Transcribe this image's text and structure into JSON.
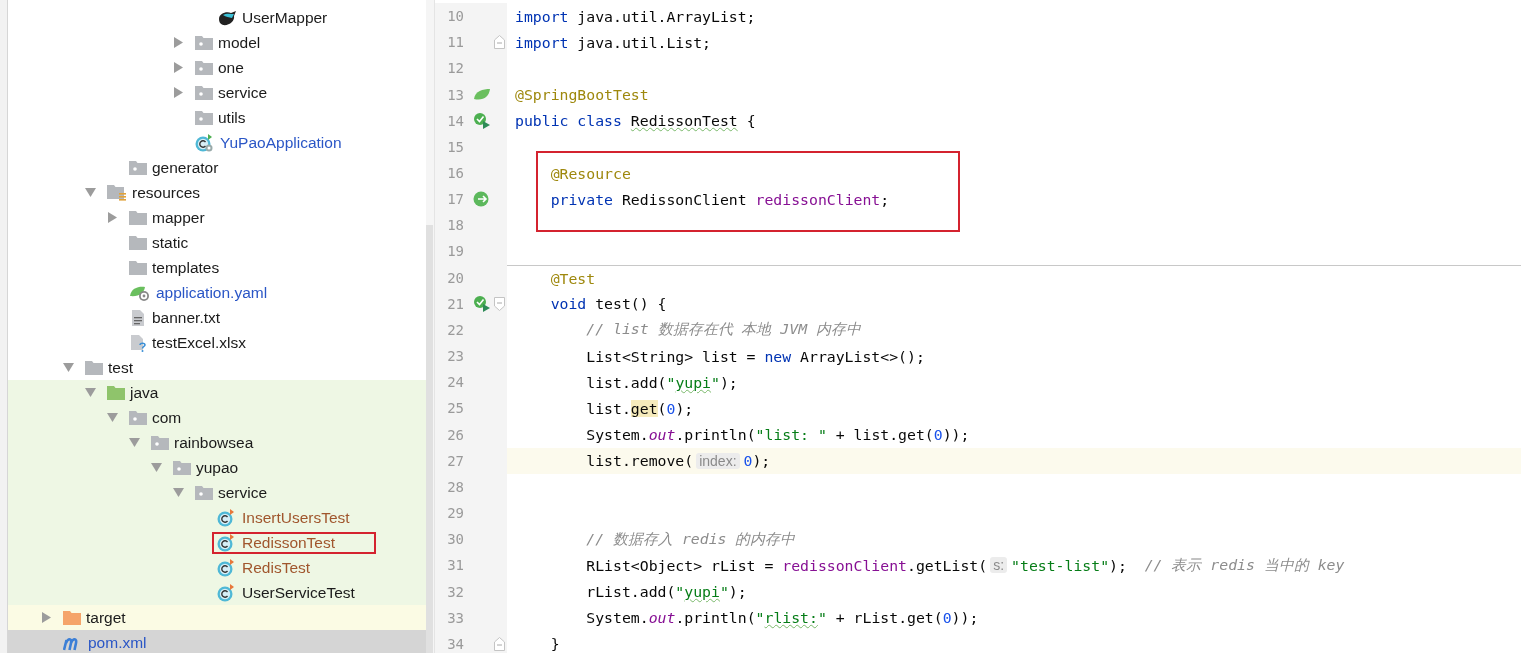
{
  "project_tree": [
    {
      "children": [
        {
          "children": [
            {
              "children": [
                {
                  "children": [
                    {
                      "children": [
                        {
                          "children": [
                            {
                              "children": [
                                {
                                  "label": "UserMapper",
                                  "kind": "mapper",
                                  "color": "#1b1b1b",
                                  "selected": false,
                                  "outlined": false
                                }
                              ]
                            },
                            {
                              "label": "model",
                              "kind": "package",
                              "expanded": false,
                              "color": "#1b1b1b",
                              "selected": false,
                              "outlined": false
                            },
                            {
                              "label": "one",
                              "kind": "package",
                              "expanded": false,
                              "color": "#1b1b1b",
                              "selected": false,
                              "outlined": false
                            },
                            {
                              "label": "service",
                              "kind": "package",
                              "expanded": false,
                              "color": "#1b1b1b",
                              "selected": false,
                              "outlined": false
                            },
                            {
                              "label": "utils",
                              "kind": "package",
                              "color": "#1b1b1b",
                              "selected": false,
                              "outlined": false
                            },
                            {
                              "label": "YuPaoApplication",
                              "kind": "spring-app",
                              "color": "#2a56c6",
                              "selected": false,
                              "outlined": false
                            }
                          ]
                        }
                      ]
                    }
                  ]
                },
                {
                  "label": "generator",
                  "kind": "package",
                  "color": "#1b1b1b",
                  "selected": false,
                  "outlined": false
                }
              ]
            },
            {
              "label": "resources",
              "kind": "resources-root",
              "expanded": true,
              "color": "#1b1b1b",
              "selected": false,
              "outlined": false,
              "children": [
                {
                  "label": "mapper",
                  "kind": "folder",
                  "expanded": false,
                  "color": "#1b1b1b",
                  "selected": false,
                  "outlined": false
                },
                {
                  "label": "static",
                  "kind": "folder",
                  "color": "#1b1b1b",
                  "selected": false,
                  "outlined": false
                },
                {
                  "label": "templates",
                  "kind": "folder",
                  "color": "#1b1b1b",
                  "selected": false,
                  "outlined": false
                },
                {
                  "label": "application.yaml",
                  "kind": "yaml",
                  "color": "#2a56c6",
                  "selected": false,
                  "outlined": false
                },
                {
                  "label": "banner.txt",
                  "kind": "text",
                  "color": "#1b1b1b",
                  "selected": false,
                  "outlined": false
                },
                {
                  "label": "testExcel.xlsx",
                  "kind": "unknown-file",
                  "color": "#1b1b1b",
                  "selected": false,
                  "outlined": false
                }
              ]
            }
          ]
        },
        {
          "label": "test",
          "kind": "folder",
          "expanded": true,
          "color": "#1b1b1b",
          "selected": false,
          "outlined": false,
          "children": [
            {
              "label": "java",
              "kind": "test-root",
              "expanded": true,
              "color": "#1b1b1b",
              "selected": false,
              "outlined": false,
              "children": [
                {
                  "label": "com",
                  "kind": "package",
                  "expanded": true,
                  "color": "#1b1b1b",
                  "selected": false,
                  "outlined": false,
                  "children": [
                    {
                      "label": "rainbowsea",
                      "kind": "package",
                      "expanded": true,
                      "color": "#1b1b1b",
                      "selected": false,
                      "outlined": false,
                      "children": [
                        {
                          "label": "yupao",
                          "kind": "package",
                          "expanded": true,
                          "color": "#1b1b1b",
                          "selected": false,
                          "outlined": false,
                          "children": [
                            {
                              "label": "service",
                              "kind": "package",
                              "expanded": true,
                              "color": "#1b1b1b",
                              "selected": false,
                              "outlined": false,
                              "children": [
                                {
                                  "label": "InsertUsersTest",
                                  "kind": "test-class",
                                  "color": "#a0562d",
                                  "selected": false,
                                  "outlined": false
                                },
                                {
                                  "label": "RedissonTest",
                                  "kind": "test-class",
                                  "color": "#a0562d",
                                  "selected": false,
                                  "outlined": true
                                },
                                {
                                  "label": "RedisTest",
                                  "kind": "test-class",
                                  "color": "#a0562d",
                                  "selected": false,
                                  "outlined": false
                                },
                                {
                                  "label": "UserServiceTest",
                                  "kind": "test-class",
                                  "color": "#1b1b1b",
                                  "selected": false,
                                  "outlined": false
                                }
                              ]
                            }
                          ]
                        }
                      ]
                    }
                  ]
                }
              ]
            }
          ]
        }
      ]
    },
    {
      "label": "target",
      "kind": "excluded-folder",
      "expanded": false,
      "color": "#1b1b1b",
      "selected": false,
      "outlined": false
    },
    {
      "label": "pom.xml",
      "kind": "maven",
      "color": "#2a56c6",
      "selected": true,
      "outlined": false
    }
  ],
  "editor": {
    "lines": [
      {
        "number": "10",
        "current": false,
        "boxed": false,
        "separator": false,
        "tokens": [
          {
            "kind": "keyword",
            "text": "import"
          },
          {
            "kind": "plain",
            "text": " java.util.ArrayList;"
          }
        ]
      },
      {
        "number": "11",
        "fold": {
          "kind": "end"
        },
        "current": false,
        "boxed": false,
        "separator": false,
        "tokens": [
          {
            "kind": "keyword",
            "text": "import"
          },
          {
            "kind": "plain",
            "text": " java.util.List;"
          }
        ]
      },
      {
        "number": "12",
        "current": false,
        "boxed": false,
        "separator": false
      },
      {
        "number": "13",
        "gutter_icon": {
          "kind": "spring-bean"
        },
        "current": false,
        "boxed": false,
        "separator": false,
        "tokens": [
          {
            "kind": "annotation",
            "text": "@SpringBootTest"
          }
        ]
      },
      {
        "number": "14",
        "gutter_icon": {
          "kind": "run"
        },
        "current": false,
        "boxed": false,
        "separator": false,
        "tokens": [
          {
            "kind": "keyword",
            "text": "public class "
          },
          {
            "kind": "typo",
            "text": "RedissonTest"
          },
          {
            "kind": "plain",
            "text": " {"
          }
        ]
      },
      {
        "number": "15",
        "current": false,
        "boxed": false,
        "separator": false
      },
      {
        "number": "16",
        "current": false,
        "boxed": true,
        "separator": false,
        "tokens": [
          {
            "kind": "annotation",
            "text": "    @Resource"
          }
        ]
      },
      {
        "number": "17",
        "gutter_icon": {
          "kind": "bean-inject"
        },
        "current": false,
        "boxed": true,
        "separator": false,
        "tokens": [
          {
            "kind": "keyword",
            "text": "    private"
          },
          {
            "kind": "plain",
            "text": " RedissonClient "
          },
          {
            "kind": "field",
            "text": "redissonClient"
          },
          {
            "kind": "plain",
            "text": ";"
          }
        ]
      },
      {
        "number": "18",
        "current": false,
        "boxed": true,
        "separator": false
      },
      {
        "number": "19",
        "current": false,
        "boxed": false,
        "separator": false
      },
      {
        "number": "20",
        "current": false,
        "boxed": false,
        "separator": true,
        "tokens": [
          {
            "kind": "annotation",
            "text": "    @Test"
          }
        ]
      },
      {
        "number": "21",
        "gutter_icon": {
          "kind": "run"
        },
        "fold": {
          "kind": "start"
        },
        "current": false,
        "boxed": false,
        "separator": false,
        "tokens": [
          {
            "kind": "keyword",
            "text": "    void"
          },
          {
            "kind": "plain",
            "text": " test() {"
          }
        ]
      },
      {
        "number": "22",
        "current": false,
        "boxed": false,
        "separator": false,
        "tokens": [
          {
            "kind": "comment",
            "text": "        // list 数据存在代 本地 JVM 内存中"
          }
        ]
      },
      {
        "number": "23",
        "current": false,
        "boxed": false,
        "separator": false,
        "tokens": [
          {
            "kind": "plain",
            "text": "        List<String> list = "
          },
          {
            "kind": "keyword",
            "text": "new"
          },
          {
            "kind": "plain",
            "text": " ArrayList<>();"
          }
        ]
      },
      {
        "number": "24",
        "current": false,
        "boxed": false,
        "separator": false,
        "tokens": [
          {
            "kind": "plain",
            "text": "        list.add("
          },
          {
            "kind": "string",
            "text": "\""
          },
          {
            "kind": "string-typo",
            "text": "yupi"
          },
          {
            "kind": "string",
            "text": "\""
          },
          {
            "kind": "plain",
            "text": ");"
          }
        ]
      },
      {
        "number": "25",
        "current": false,
        "boxed": false,
        "separator": false,
        "tokens": [
          {
            "kind": "plain",
            "text": "        list."
          },
          {
            "kind": "usage",
            "text": "get"
          },
          {
            "kind": "plain",
            "text": "("
          },
          {
            "kind": "number",
            "text": "0"
          },
          {
            "kind": "plain",
            "text": ");"
          }
        ]
      },
      {
        "number": "26",
        "current": false,
        "boxed": false,
        "separator": false,
        "tokens": [
          {
            "kind": "plain",
            "text": "        System."
          },
          {
            "kind": "static",
            "text": "out"
          },
          {
            "kind": "plain",
            "text": ".println("
          },
          {
            "kind": "string",
            "text": "\"list: \""
          },
          {
            "kind": "plain",
            "text": " + list.get("
          },
          {
            "kind": "number",
            "text": "0"
          },
          {
            "kind": "plain",
            "text": "));"
          }
        ]
      },
      {
        "number": "27",
        "current": true,
        "boxed": false,
        "separator": false,
        "tokens": [
          {
            "kind": "plain",
            "text": "        list.remove("
          },
          {
            "kind": "hint",
            "text": "index:"
          },
          {
            "kind": "number",
            "text": "0"
          },
          {
            "kind": "plain",
            "text": ");"
          }
        ]
      },
      {
        "number": "28",
        "current": false,
        "boxed": false,
        "separator": false
      },
      {
        "number": "29",
        "current": false,
        "boxed": false,
        "separator": false
      },
      {
        "number": "30",
        "current": false,
        "boxed": false,
        "separator": false,
        "tokens": [
          {
            "kind": "comment",
            "text": "        // 数据存入 redis 的内存中"
          }
        ]
      },
      {
        "number": "31",
        "current": false,
        "boxed": false,
        "separator": false,
        "tokens": [
          {
            "kind": "plain",
            "text": "        RList<Object> rList = "
          },
          {
            "kind": "field",
            "text": "redissonClient"
          },
          {
            "kind": "plain",
            "text": ".getList("
          },
          {
            "kind": "hint",
            "text": "s:"
          },
          {
            "kind": "string",
            "text": "\"test-list\""
          },
          {
            "kind": "plain",
            "text": ");  "
          },
          {
            "kind": "comment",
            "text": "// 表示 redis 当中的 key"
          }
        ]
      },
      {
        "number": "32",
        "current": false,
        "boxed": false,
        "separator": false,
        "tokens": [
          {
            "kind": "plain",
            "text": "        rList.add("
          },
          {
            "kind": "string",
            "text": "\""
          },
          {
            "kind": "string-typo",
            "text": "yupi"
          },
          {
            "kind": "string",
            "text": "\""
          },
          {
            "kind": "plain",
            "text": ");"
          }
        ]
      },
      {
        "number": "33",
        "current": false,
        "boxed": false,
        "separator": false,
        "tokens": [
          {
            "kind": "plain",
            "text": "        System."
          },
          {
            "kind": "static",
            "text": "out"
          },
          {
            "kind": "plain",
            "text": ".println("
          },
          {
            "kind": "string",
            "text": "\""
          },
          {
            "kind": "string-typo",
            "text": "rlist:"
          },
          {
            "kind": "string",
            "text": "\""
          },
          {
            "kind": "plain",
            "text": " + rList.get("
          },
          {
            "kind": "number",
            "text": "0"
          },
          {
            "kind": "plain",
            "text": "));"
          }
        ]
      },
      {
        "number": "34",
        "fold": {
          "kind": "end"
        },
        "current": false,
        "boxed": false,
        "separator": false,
        "tokens": [
          {
            "kind": "plain",
            "text": "    }"
          }
        ]
      }
    ]
  }
}
